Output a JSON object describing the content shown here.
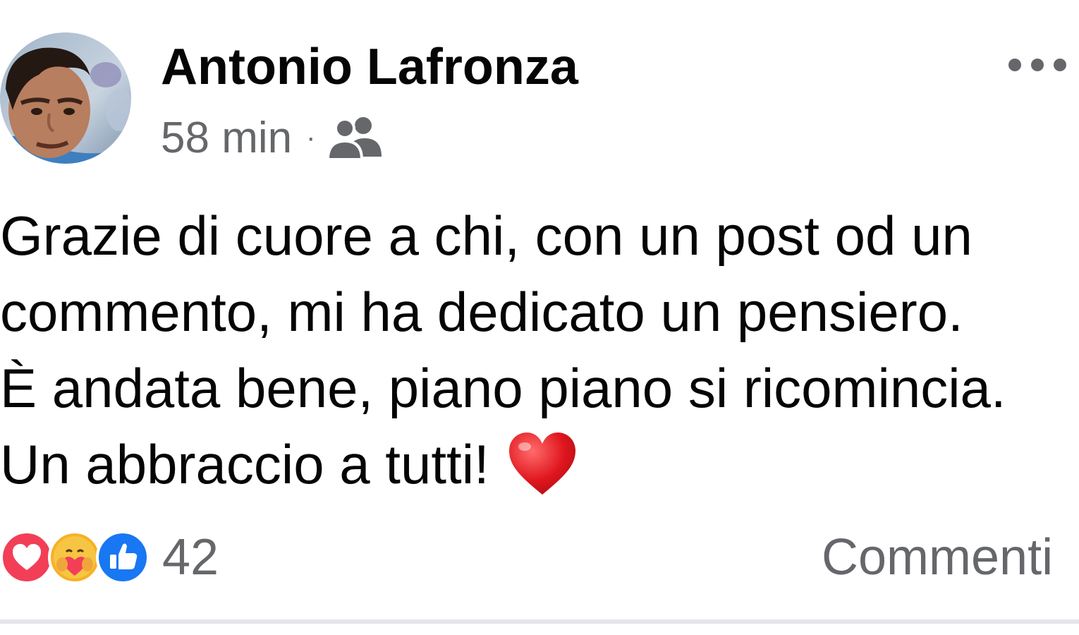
{
  "post": {
    "author": {
      "name": "Antonio Lafronza",
      "avatar_icon": "profile-photo"
    },
    "meta": {
      "time": "58 min",
      "separator": "·",
      "audience_icon": "friends-icon"
    },
    "more_icon": "more-options-icon",
    "text_lines": [
      "Grazie di cuore a chi, con un post od un",
      "commento, mi ha dedicato un pensiero.",
      "È andata bene, piano piano si ricomincia.",
      "Un abbraccio a tutti!"
    ],
    "text_emoji": "red-heart-emoji",
    "reactions": {
      "icons": [
        "love-reaction-icon",
        "care-reaction-icon",
        "like-reaction-icon"
      ],
      "count": "42"
    },
    "comments_label": "Commenti"
  },
  "colors": {
    "primary_text": "#050505",
    "secondary_text": "#65676b",
    "like_blue": "#1877f2",
    "love_red": "#f33e58",
    "care_yellow": "#f7b125",
    "divider": "#e4e6eb"
  }
}
